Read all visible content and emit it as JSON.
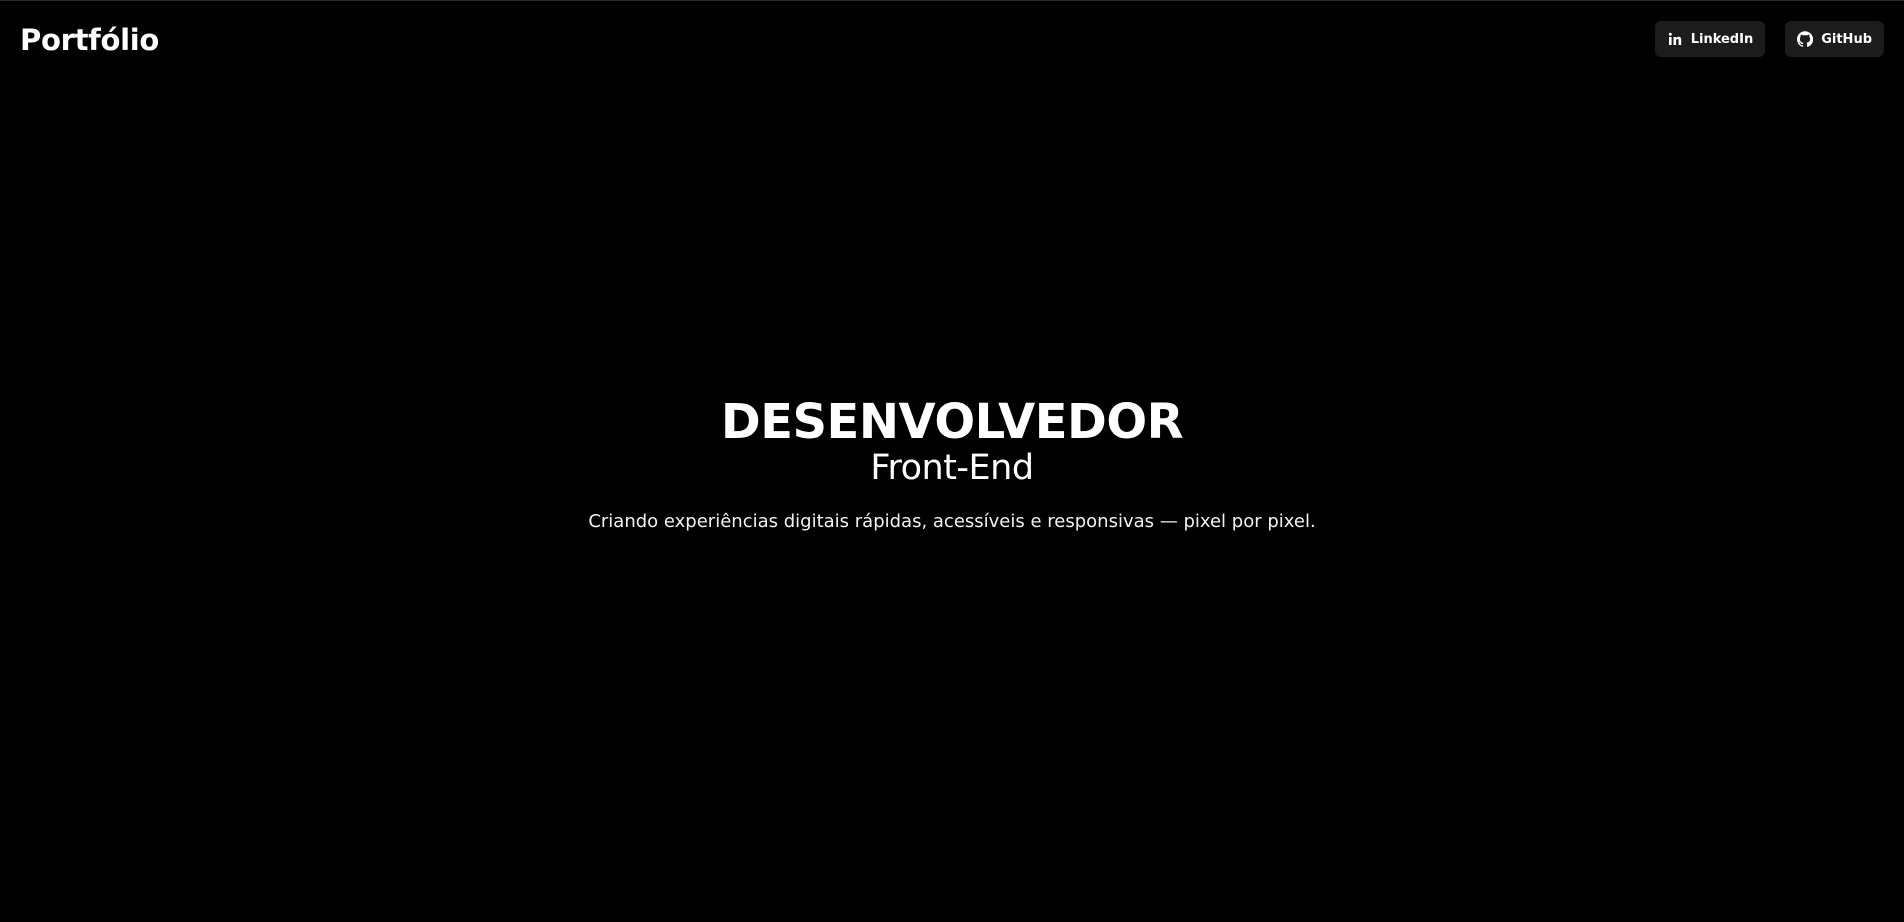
{
  "header": {
    "brand": "Portfólio",
    "links": [
      {
        "label": "LinkedIn",
        "icon": "linkedin-icon"
      },
      {
        "label": "GitHub",
        "icon": "github-icon"
      }
    ]
  },
  "hero": {
    "title": "DESENVOLVEDOR",
    "subtitle": "Front-End",
    "tagline": "Criando experiências digitais rápidas, acessíveis e responsivas — pixel por pixel."
  },
  "colors": {
    "background": "#000000",
    "text": "#ffffff",
    "button_bg": "#1c1c1c"
  }
}
